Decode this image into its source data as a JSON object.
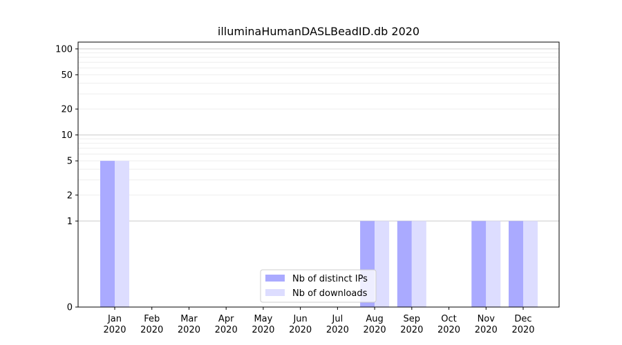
{
  "chart_data": {
    "type": "bar",
    "title": "illuminaHumanDASLBeadID.db 2020",
    "xlabel": "",
    "ylabel": "",
    "y_scale": "symlog",
    "ylim": [
      0,
      120
    ],
    "y_ticks": [
      0,
      1,
      2,
      5,
      10,
      20,
      50,
      100
    ],
    "grid": "y-axis, major and minor",
    "legend_position": "bottom-center",
    "categories": [
      [
        "Jan",
        "2020"
      ],
      [
        "Feb",
        "2020"
      ],
      [
        "Mar",
        "2020"
      ],
      [
        "Apr",
        "2020"
      ],
      [
        "May",
        "2020"
      ],
      [
        "Jun",
        "2020"
      ],
      [
        "Jul",
        "2020"
      ],
      [
        "Aug",
        "2020"
      ],
      [
        "Sep",
        "2020"
      ],
      [
        "Oct",
        "2020"
      ],
      [
        "Nov",
        "2020"
      ],
      [
        "Dec",
        "2020"
      ]
    ],
    "series": [
      {
        "name": "Nb of distinct IPs",
        "color": "#aaaaff",
        "values": [
          5,
          0,
          0,
          0,
          0,
          0,
          0,
          1,
          1,
          0,
          1,
          1
        ]
      },
      {
        "name": "Nb of downloads",
        "color": "#ddddff",
        "values": [
          5,
          0,
          0,
          0,
          0,
          0,
          0,
          1,
          1,
          0,
          1,
          1
        ]
      }
    ]
  }
}
